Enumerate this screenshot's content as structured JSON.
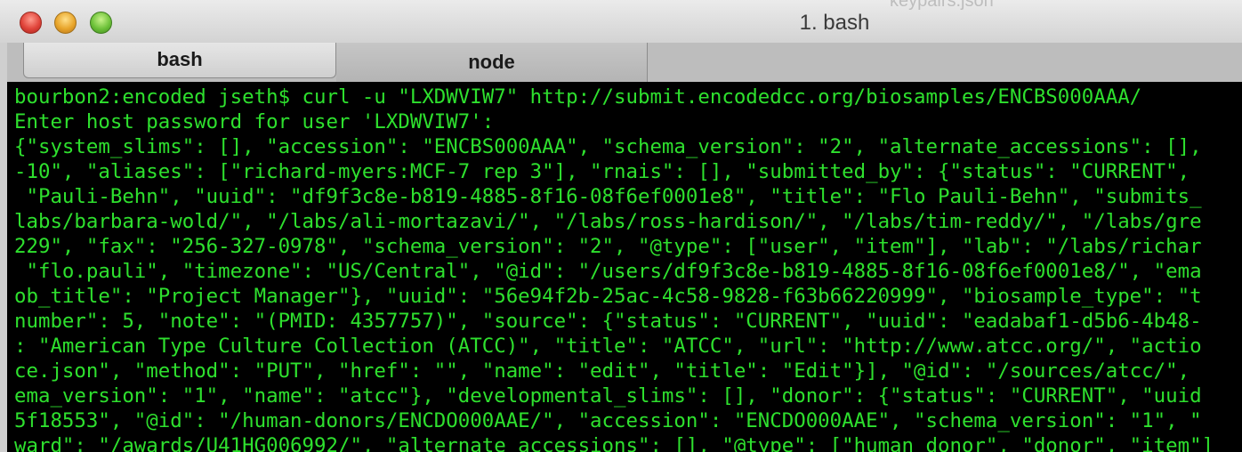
{
  "window": {
    "title": "1. bash",
    "behind_title": "keypairs.json"
  },
  "tabs": [
    {
      "label": "bash",
      "active": true
    },
    {
      "label": "node",
      "active": false
    }
  ],
  "terminal": {
    "text_color": "#2ee02e",
    "background": "#000000",
    "lines": [
      "bourbon2:encoded jseth$ curl -u \"LXDWVIW7\" http://submit.encodedcc.org/biosamples/ENCBS000AAA/",
      "Enter host password for user 'LXDWVIW7':",
      "{\"system_slims\": [], \"accession\": \"ENCBS000AAA\", \"schema_version\": \"2\", \"alternate_accessions\": [],",
      "-10\", \"aliases\": [\"richard-myers:MCF-7 rep 3\"], \"rnais\": [], \"submitted_by\": {\"status\": \"CURRENT\",",
      " \"Pauli-Behn\", \"uuid\": \"df9f3c8e-b819-4885-8f16-08f6ef0001e8\", \"title\": \"Flo Pauli-Behn\", \"submits_",
      "labs/barbara-wold/\", \"/labs/ali-mortazavi/\", \"/labs/ross-hardison/\", \"/labs/tim-reddy/\", \"/labs/gre",
      "229\", \"fax\": \"256-327-0978\", \"schema_version\": \"2\", \"@type\": [\"user\", \"item\"], \"lab\": \"/labs/richar",
      " \"flo.pauli\", \"timezone\": \"US/Central\", \"@id\": \"/users/df9f3c8e-b819-4885-8f16-08f6ef0001e8/\", \"ema",
      "ob_title\": \"Project Manager\"}, \"uuid\": \"56e94f2b-25ac-4c58-9828-f63b66220999\", \"biosample_type\": \"t",
      "number\": 5, \"note\": \"(PMID: 4357757)\", \"source\": {\"status\": \"CURRENT\", \"uuid\": \"eadabaf1-d5b6-4b48-",
      ": \"American Type Culture Collection (ATCC)\", \"title\": \"ATCC\", \"url\": \"http://www.atcc.org/\", \"actio",
      "ce.json\", \"method\": \"PUT\", \"href\": \"\", \"name\": \"edit\", \"title\": \"Edit\"}], \"@id\": \"/sources/atcc/\",",
      "ema_version\": \"1\", \"name\": \"atcc\"}, \"developmental_slims\": [], \"donor\": {\"status\": \"CURRENT\", \"uuid",
      "5f18553\", \"@id\": \"/human-donors/ENCDO000AAE/\", \"accession\": \"ENCDO000AAE\", \"schema_version\": \"1\", \"",
      "ward\": \"/awards/U41HG006992/\", \"alternate_accessions\": [], \"@type\": [\"human_donor\", \"donor\", \"item\"]"
    ]
  }
}
